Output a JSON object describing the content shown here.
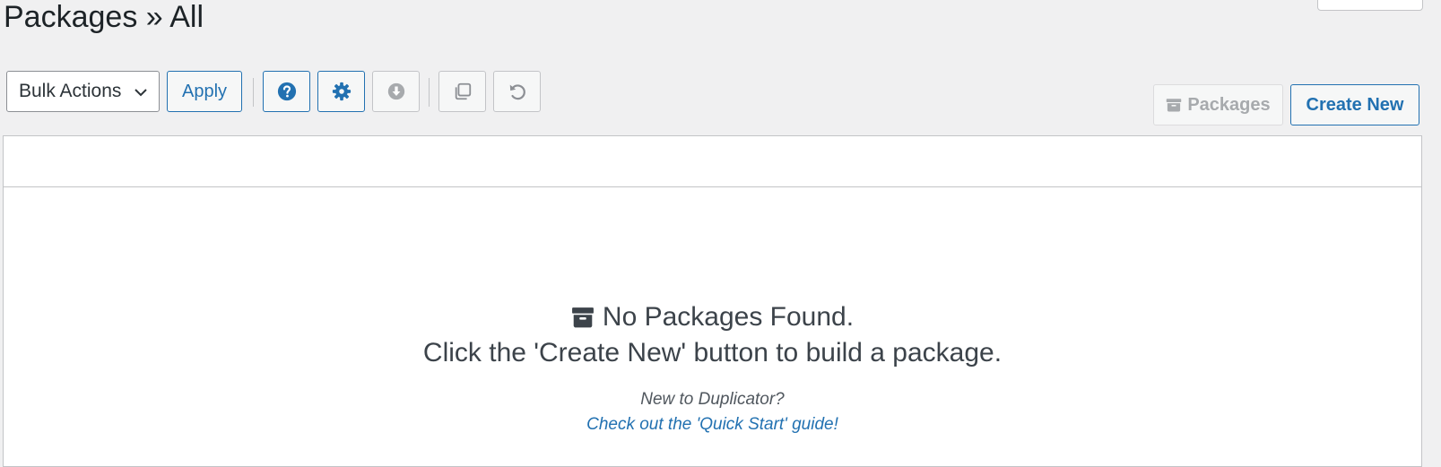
{
  "header": {
    "title": "Packages » All"
  },
  "toolbar": {
    "bulk_actions_label": "Bulk Actions",
    "apply_label": "Apply",
    "icons": [
      "help-icon",
      "gear-icon",
      "download-icon",
      "copy-icon",
      "undo-icon"
    ]
  },
  "actions": {
    "packages_label": "Packages",
    "create_new_label": "Create New"
  },
  "empty_state": {
    "title": "No Packages Found.",
    "message": "Click the 'Create New' button to build a package.",
    "intro": "New to Duplicator?",
    "guide_link": "Check out the 'Quick Start' guide!"
  },
  "colors": {
    "accent": "#2271b1",
    "background": "#f0f0f1",
    "disabled": "#a7aaad"
  }
}
